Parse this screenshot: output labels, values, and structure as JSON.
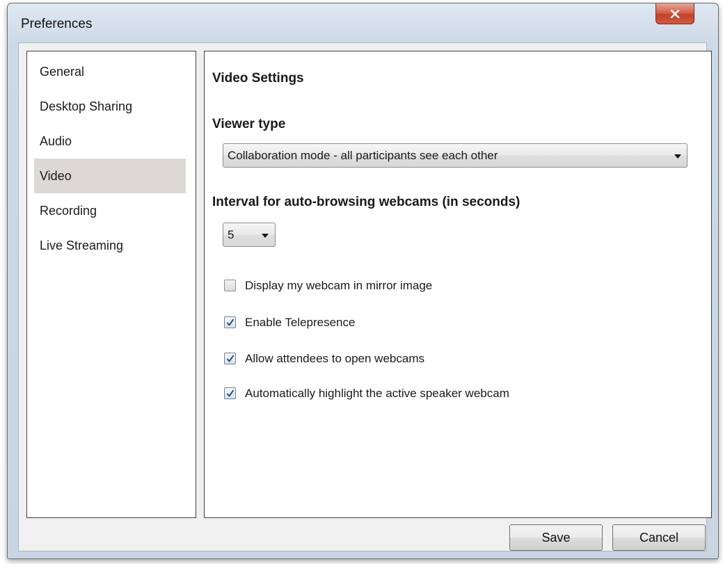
{
  "window": {
    "title": "Preferences",
    "close_icon": "close-icon"
  },
  "sidebar": {
    "items": [
      {
        "label": "General",
        "selected": false
      },
      {
        "label": "Desktop Sharing",
        "selected": false
      },
      {
        "label": "Audio",
        "selected": false
      },
      {
        "label": "Video",
        "selected": true
      },
      {
        "label": "Recording",
        "selected": false
      },
      {
        "label": "Live Streaming",
        "selected": false
      }
    ]
  },
  "content": {
    "title": "Video Settings",
    "viewer_type": {
      "label": "Viewer type",
      "value": "Collaboration mode - all participants see each other"
    },
    "interval": {
      "label": "Interval for auto-browsing webcams (in seconds)",
      "value": "5"
    },
    "options": [
      {
        "label": "Display my webcam in mirror image",
        "checked": false
      },
      {
        "label": "Enable Telepresence",
        "checked": true
      },
      {
        "label": "Allow attendees to open webcams",
        "checked": true
      },
      {
        "label": "Automatically highlight the active speaker webcam",
        "checked": true
      }
    ]
  },
  "footer": {
    "save_label": "Save",
    "cancel_label": "Cancel"
  },
  "colors": {
    "selected_item_bg": "#dcd9d5",
    "close_button": "#c2412a",
    "title_bar": "#ccd9e6"
  }
}
